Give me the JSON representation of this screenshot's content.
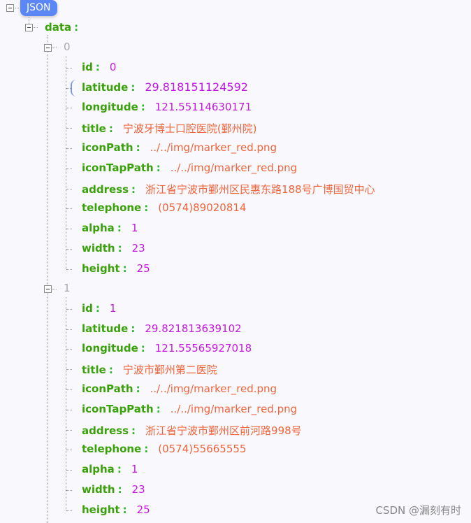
{
  "root_label": "JSON",
  "data_key": "data",
  "colon": ":",
  "items": [
    {
      "index": "0",
      "fields": [
        {
          "key": "id",
          "value": "0",
          "type": "number"
        },
        {
          "key": "latitude",
          "value": "29.818151124592",
          "type": "number",
          "highlighted": true
        },
        {
          "key": "longitude",
          "value": "121.55114630171",
          "type": "number"
        },
        {
          "key": "title",
          "value": "宁波牙博士口腔医院(鄞州院)",
          "type": "string"
        },
        {
          "key": "iconPath",
          "value": "../../img/marker_red.png",
          "type": "string"
        },
        {
          "key": "iconTapPath",
          "value": "../../img/marker_red.png",
          "type": "string"
        },
        {
          "key": "address",
          "value": "浙江省宁波市鄞州区民惠东路188号广博国贸中心",
          "type": "string"
        },
        {
          "key": "telephone",
          "value": "(0574)89020814",
          "type": "string"
        },
        {
          "key": "alpha",
          "value": "1",
          "type": "number"
        },
        {
          "key": "width",
          "value": "23",
          "type": "number"
        },
        {
          "key": "height",
          "value": "25",
          "type": "number"
        }
      ]
    },
    {
      "index": "1",
      "fields": [
        {
          "key": "id",
          "value": "1",
          "type": "number"
        },
        {
          "key": "latitude",
          "value": "29.821813639102",
          "type": "number"
        },
        {
          "key": "longitude",
          "value": "121.55565927018",
          "type": "number"
        },
        {
          "key": "title",
          "value": "宁波市鄞州第二医院",
          "type": "string"
        },
        {
          "key": "iconPath",
          "value": "../../img/marker_red.png",
          "type": "string"
        },
        {
          "key": "iconTapPath",
          "value": "../../img/marker_red.png",
          "type": "string"
        },
        {
          "key": "address",
          "value": "浙江省宁波市鄞州区前河路998号",
          "type": "string"
        },
        {
          "key": "telephone",
          "value": "(0574)55665555",
          "type": "string"
        },
        {
          "key": "alpha",
          "value": "1",
          "type": "number"
        },
        {
          "key": "width",
          "value": "23",
          "type": "number"
        },
        {
          "key": "height",
          "value": "25",
          "type": "number"
        }
      ]
    }
  ],
  "watermark": "CSDN @漏刻有时",
  "colors": {
    "key": "#3aa10a",
    "number": "#c41ae0",
    "string": "#f0643c",
    "root_badge": "#5b86f5"
  }
}
